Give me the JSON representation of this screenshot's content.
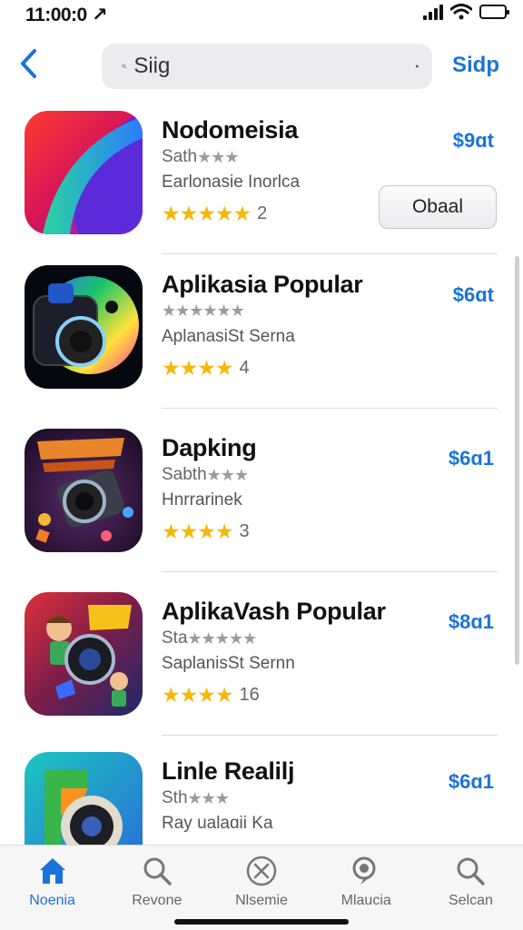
{
  "status_bar": {
    "time": "11:00:0 ↗"
  },
  "search": {
    "value": "Siig",
    "action_label": "Sidp"
  },
  "results": [
    {
      "name": "Nodomeisia",
      "sub_text": "Sath",
      "sub_stars": "★★★",
      "category": "Earlonasie Inorlca",
      "stars": "★★★★★",
      "rating_count": "2",
      "price": "$9ɑt",
      "button_label": "Obaal"
    },
    {
      "name": "Aplikasia Popular",
      "sub_text": "",
      "sub_stars": "★★★★★★",
      "category": "AplanasiSt Serna",
      "stars": "★★★★",
      "rating_count": "4",
      "price": "$6ɑt"
    },
    {
      "name": "Dapking",
      "sub_text": "Sabth",
      "sub_stars": "★★★",
      "category": "Hnrrarinek",
      "stars": "★★★★",
      "rating_count": "3",
      "price": "$6ɑ1"
    },
    {
      "name": "AplikaVash Popular",
      "sub_text": "Sta",
      "sub_stars": "★★★★★",
      "category": "SaplanisSt Sernn",
      "stars": "★★★★",
      "rating_count": "16",
      "price": "$8ɑ1"
    },
    {
      "name": "Linle Realilj",
      "sub_text": "Sth",
      "sub_stars": "★★★",
      "category": "Ray ualaɑii Ka",
      "stars": "★★★",
      "rating_count": "",
      "price": "$6ɑ1"
    }
  ],
  "tabs": [
    {
      "label": "Noenia",
      "icon": "home-icon",
      "active": true
    },
    {
      "label": "Revone",
      "icon": "search-icon",
      "active": false
    },
    {
      "label": "Nlsemie",
      "icon": "close-circle-icon",
      "active": false
    },
    {
      "label": "Mlaucia",
      "icon": "search-bubble-icon",
      "active": false
    },
    {
      "label": "Selcan",
      "icon": "search-icon",
      "active": false
    }
  ],
  "colors": {
    "accent": "#1a73d9",
    "star": "#f5b80a",
    "background": "#ffffff"
  }
}
